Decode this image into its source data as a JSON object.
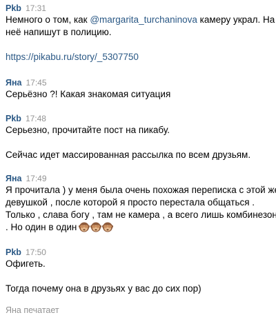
{
  "messages": [
    {
      "author": "Pkb",
      "time": "17:31",
      "line1_pre": "Немного о том, как ",
      "line1_mention": "@margarita_turchaninova",
      "line1_post": " камеру украл. На",
      "line2": "неё напишут в полицию.",
      "link": "https://pikabu.ru/story/_5307750"
    },
    {
      "author": "Яна",
      "time": "17:45",
      "line1": "Серьёзно ?! Какая знакомая ситуация"
    },
    {
      "author": "Pkb",
      "time": "17:48",
      "line1": "Серьезно, прочитайте пост на пикабу.",
      "line2": "Сейчас идет массированная рассылка по всем друзьям."
    },
    {
      "author": "Яна",
      "time": "17:49",
      "line1": "Я прочитала ) у меня была очень похожая переписка с этой же",
      "line2": "девушкой , после которой я просто перестала общаться .",
      "line3": "Только , слава богу , там не камера , а всего лишь комбинезон",
      "line4": ". Но один в один",
      "emoji": [
        "see-no-evil-monkey-emoji",
        "see-no-evil-monkey-emoji",
        "see-no-evil-monkey-emoji"
      ]
    },
    {
      "author": "Pkb",
      "time": "17:50",
      "line1": "Офигеть.",
      "line2": "Тогда почему она в друзьях у вас до сих пор)"
    }
  ],
  "typing_indicator": "Яна печатает",
  "colors": {
    "author": "#2a5885",
    "time": "#939393",
    "link": "#2a5885",
    "text": "#000000"
  }
}
